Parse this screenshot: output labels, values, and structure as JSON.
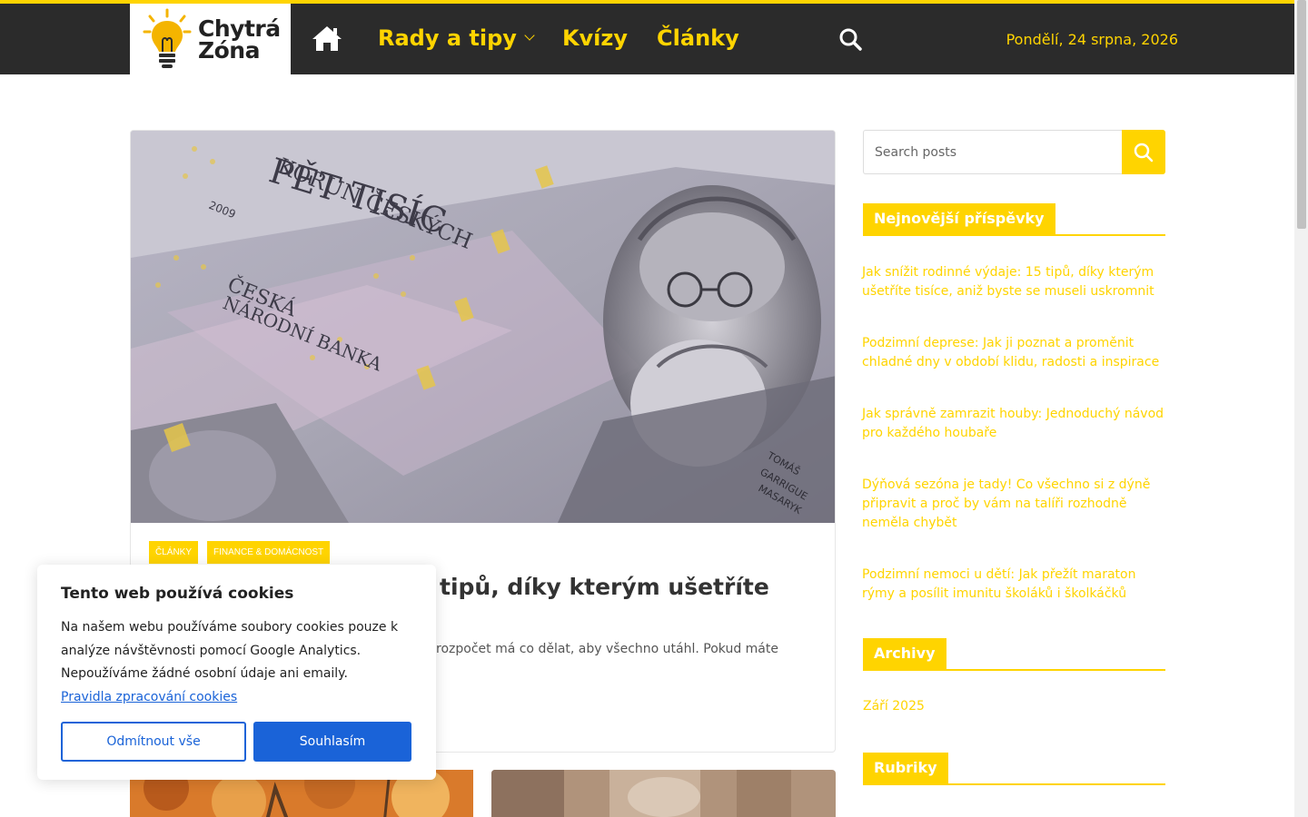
{
  "colors": {
    "accent": "#ffd400",
    "header_bg": "#2b2b2b",
    "cookie_blue": "#1a63d8"
  },
  "logo": {
    "line1": "Chytrá",
    "line2": "Zóna",
    "icon": "lightbulb-icon"
  },
  "nav": {
    "home_icon": "home-icon",
    "items": [
      {
        "label": "Rady a tipy",
        "has_dropdown": true
      },
      {
        "label": "Kvízy"
      },
      {
        "label": "Články"
      }
    ],
    "search_icon": "search-icon"
  },
  "header": {
    "date": "Pondělí, 24 srpna, 2026"
  },
  "article": {
    "image": "czech-banknote-5000-korun-photo",
    "tags": [
      "Články",
      "Finance & domácnost"
    ],
    "title_visible": "tipů, díky kterým ušetříte tisíce, aniž",
    "excerpt_visible": "rozpočet má co dělat, aby všechno utáhl. Pokud máte pocit, že"
  },
  "sidebar": {
    "search": {
      "placeholder": "Search posts",
      "value": ""
    },
    "recent": {
      "title": "Nejnovější příspěvky",
      "items": [
        "Jak snížit rodinné výdaje: 15 tipů, díky kterým ušetříte tisíce, aniž byste se museli uskromnit",
        "Podzimní deprese: Jak ji poznat a proměnit chladné dny v období klidu, radosti a inspirace",
        "Jak správně zamrazit houby: Jednoduchý návod pro každého houbaře",
        "Dýňová sezóna je tady! Co všechno si z dýně připravit a proč by vám na talíři rozhodně neměla chybět",
        "Podzimní nemoci u dětí: Jak přežít maraton rýmy a posílit imunitu školáků i školkáčků"
      ]
    },
    "archives": {
      "title": "Archivy",
      "items": [
        "Září 2025"
      ]
    },
    "categories": {
      "title": "Rubriky"
    }
  },
  "cookie": {
    "title": "Tento web používá cookies",
    "text": "Na našem webu používáme soubory cookies pouze k analýze návštěvnosti pomocí Google Analytics. Nepoužíváme žádné osobní údaje ani emaily.",
    "link": "Pravidla zpracování cookies",
    "reject": "Odmítnout vše",
    "accept": "Souhlasím"
  }
}
